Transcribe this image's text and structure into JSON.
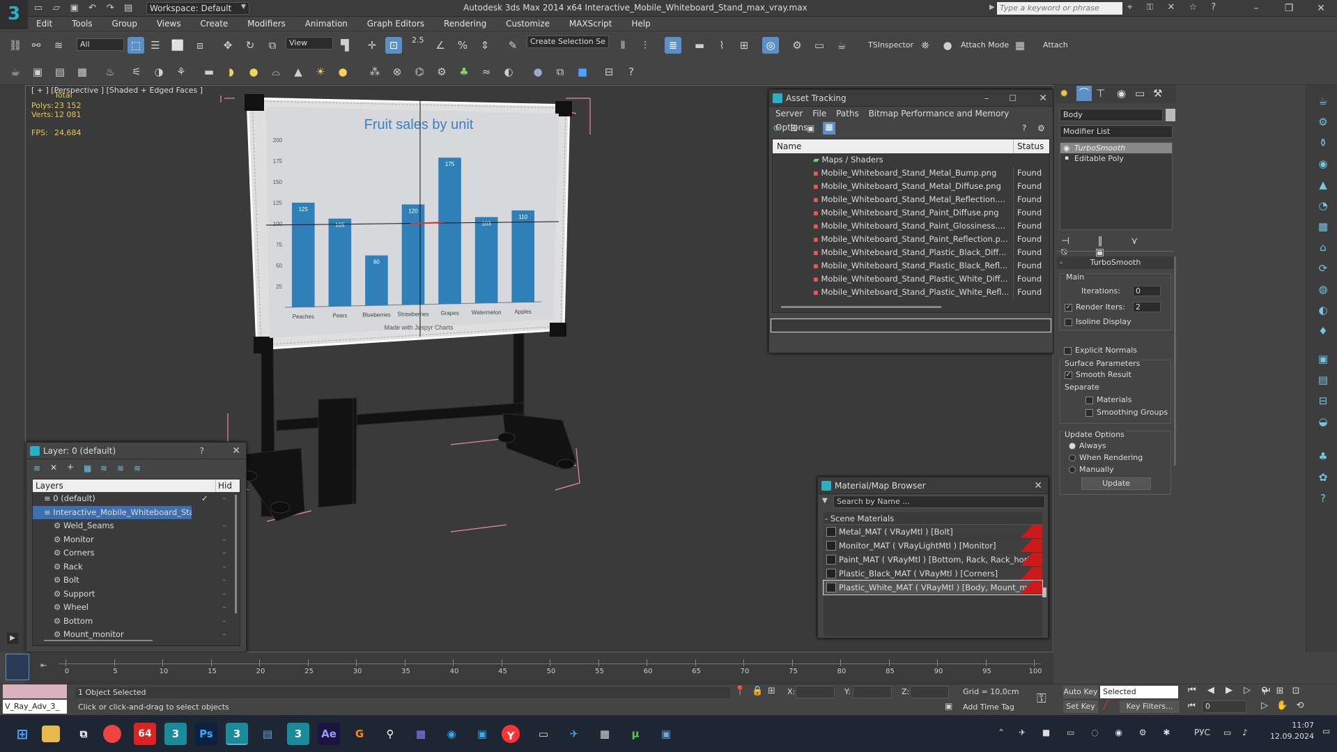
{
  "window": {
    "title": "Autodesk 3ds Max  2014 x64    Interactive_Mobile_Whiteboard_Stand_max_vray.max",
    "workspace": "Workspace: Default",
    "search_placeholder": "Type a keyword or phrase"
  },
  "menu": [
    "Edit",
    "Tools",
    "Group",
    "Views",
    "Create",
    "Modifiers",
    "Animation",
    "Graph Editors",
    "Rendering",
    "Customize",
    "MAXScript",
    "Help"
  ],
  "toolbar": {
    "filter": "All",
    "refcoord": "View",
    "selection_set": "Create Selection Se",
    "snap_angle": "2.5",
    "tsinspector": "TSInspector",
    "attach_mode": "Attach Mode",
    "attach": "Attach"
  },
  "viewport": {
    "label": "[ + ] [Perspective ] [Shaded + Edged Faces ]",
    "stats": {
      "total_label": "Total",
      "polys_label": "Polys:",
      "polys": "23 152",
      "verts_label": "Verts:",
      "verts": "12 081",
      "fps_label": "FPS:",
      "fps": "24,684"
    }
  },
  "whiteboard_chart": {
    "title": "Fruit sales by unit",
    "footer": "Made with Jaspyr Charts",
    "yticks": [
      "200",
      "175",
      "150",
      "125",
      "100",
      "75",
      "50",
      "25"
    ]
  },
  "chart_data": {
    "type": "bar",
    "title": "Fruit sales by unit",
    "categories": [
      "Peaches",
      "Pears",
      "Blueberries",
      "Strawberries",
      "Grapes",
      "Watermelon",
      "Apples"
    ],
    "values": [
      125,
      105,
      60,
      120,
      175,
      103,
      110
    ],
    "ylim": [
      0,
      200
    ],
    "xlabel": "",
    "ylabel": "",
    "colors": [
      "#2f7fb8"
    ]
  },
  "asset_tracking": {
    "title": "Asset Tracking",
    "menu": [
      "Server",
      "File",
      "Paths",
      "Bitmap Performance and Memory",
      "Options"
    ],
    "col_name": "Name",
    "col_status": "Status",
    "group": "Maps / Shaders",
    "rows": [
      {
        "name": "Mobile_Whiteboard_Stand_Metal_Bump.png",
        "status": "Found"
      },
      {
        "name": "Mobile_Whiteboard_Stand_Metal_Diffuse.png",
        "status": "Found"
      },
      {
        "name": "Mobile_Whiteboard_Stand_Metal_Reflection....",
        "status": "Found"
      },
      {
        "name": "Mobile_Whiteboard_Stand_Paint_Diffuse.png",
        "status": "Found"
      },
      {
        "name": "Mobile_Whiteboard_Stand_Paint_Glossiness....",
        "status": "Found"
      },
      {
        "name": "Mobile_Whiteboard_Stand_Paint_Reflection.p...",
        "status": "Found"
      },
      {
        "name": "Mobile_Whiteboard_Stand_Plastic_Black_Diff...",
        "status": "Found"
      },
      {
        "name": "Mobile_Whiteboard_Stand_Plastic_Black_Refl...",
        "status": "Found"
      },
      {
        "name": "Mobile_Whiteboard_Stand_Plastic_White_Diff...",
        "status": "Found"
      },
      {
        "name": "Mobile_Whiteboard_Stand_Plastic_White_Refl...",
        "status": "Found"
      }
    ]
  },
  "layer_panel": {
    "title": "Layer: 0 (default)",
    "col_layers": "Layers",
    "col_hide": "Hid",
    "layers": [
      {
        "name": "0 (default)",
        "indent": 1,
        "selected": false
      },
      {
        "name": "Interactive_Mobile_Whiteboard_Stand",
        "indent": 1,
        "selected": true
      },
      {
        "name": "Weld_Seams",
        "indent": 2,
        "selected": false
      },
      {
        "name": "Monitor",
        "indent": 2,
        "selected": false
      },
      {
        "name": "Corners",
        "indent": 2,
        "selected": false
      },
      {
        "name": "Rack",
        "indent": 2,
        "selected": false
      },
      {
        "name": "Bolt",
        "indent": 2,
        "selected": false
      },
      {
        "name": "Support",
        "indent": 2,
        "selected": false
      },
      {
        "name": "Wheel",
        "indent": 2,
        "selected": false
      },
      {
        "name": "Bottom",
        "indent": 2,
        "selected": false
      },
      {
        "name": "Mount_monitor",
        "indent": 2,
        "selected": false
      }
    ]
  },
  "material_browser": {
    "title": "Material/Map Browser",
    "search_placeholder": "Search by Name ...",
    "section": "Scene Materials",
    "items": [
      "Metal_MAT  ( VRayMtl )  [Bolt]",
      "Monitor_MAT  ( VRayLightMtl )  [Monitor]",
      "Paint_MAT  ( VRayMtl )  [Bottom, Rack, Rack_horizo...",
      "Plastic_Black_MAT  ( VRayMtl )  [Corners]",
      "Plastic_White_MAT  ( VRayMtl )  [Body, Mount_moni..."
    ]
  },
  "modify_panel": {
    "object_name": "Body",
    "modifier_list": "Modifier List",
    "stack": [
      "TurboSmooth",
      "Editable Poly"
    ],
    "rollout_title": "TurboSmooth",
    "main": "Main",
    "iterations_label": "Iterations:",
    "iterations": "0",
    "render_iters_label": "Render Iters:",
    "render_iters": "2",
    "isoline": "Isoline Display",
    "explicit": "Explicit Normals",
    "surface_params": "Surface Parameters",
    "smooth_result": "Smooth Result",
    "separate": "Separate",
    "materials": "Materials",
    "smoothing_groups": "Smoothing Groups",
    "update_options": "Update Options",
    "always": "Always",
    "when_rendering": "When Rendering",
    "manually": "Manually",
    "update_btn": "Update"
  },
  "timeline": {
    "slider": "0 / 100",
    "ticks": [
      "0",
      "5",
      "10",
      "15",
      "20",
      "25",
      "30",
      "35",
      "40",
      "45",
      "50",
      "55",
      "60",
      "65",
      "70",
      "75",
      "80",
      "85",
      "90",
      "95",
      "100"
    ]
  },
  "status": {
    "script_listener": "V_Ray_Adv_3_",
    "selected": "1 Object Selected",
    "prompt": "Click or click-and-drag to select objects",
    "x_label": "X:",
    "y_label": "Y:",
    "z_label": "Z:",
    "grid": "Grid = 10,0cm",
    "add_time_tag": "Add Time Tag",
    "auto_key": "Auto Key",
    "selected_dd": "Selected",
    "set_key": "Set Key",
    "key_filters": "Key Filters...",
    "frame": "0"
  },
  "taskbar": {
    "lang": "РУС",
    "time": "11:07",
    "date": "12.09.2024"
  }
}
